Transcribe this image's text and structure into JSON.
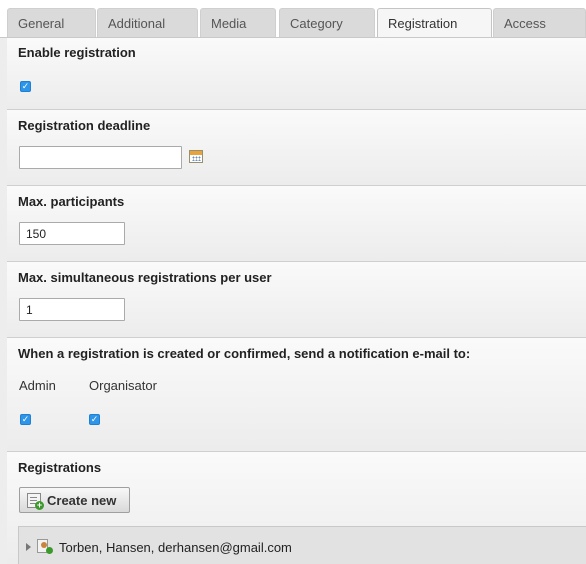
{
  "tabs": [
    {
      "label": "General",
      "active": false
    },
    {
      "label": "Additional",
      "active": false
    },
    {
      "label": "Media",
      "active": false
    },
    {
      "label": "Category",
      "active": false
    },
    {
      "label": "Registration",
      "active": true
    },
    {
      "label": "Access",
      "active": false
    }
  ],
  "enable_registration": {
    "label": "Enable registration",
    "checked": true
  },
  "registration_deadline": {
    "label": "Registration deadline",
    "value": ""
  },
  "max_participants": {
    "label": "Max. participants",
    "value": "150"
  },
  "max_simultaneous": {
    "label": "Max. simultaneous registrations per user",
    "value": "1"
  },
  "notification": {
    "label": "When a registration is created or confirmed, send a notification e-mail to:",
    "options": [
      {
        "label": "Admin",
        "checked": true
      },
      {
        "label": "Organisator",
        "checked": true
      }
    ]
  },
  "registrations": {
    "label": "Registrations",
    "create_new_label": "Create new",
    "items": [
      {
        "text": "Torben, Hansen, derhansen@gmail.com"
      }
    ]
  },
  "colors": {
    "checkbox": "#2e95e8",
    "panel_background": "#ededed",
    "active_tab": "#f6f6f6"
  }
}
